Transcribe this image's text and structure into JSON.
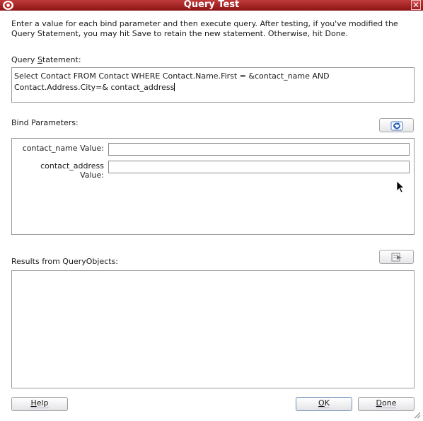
{
  "window": {
    "title": "Query Test",
    "close_glyph": "✕"
  },
  "instructions": "Enter a value for each bind parameter and then execute query. After testing, if you've modified the Query Statement, you may hit Save to retain the new statement.  Otherwise, hit Done.",
  "query_statement": {
    "label_before": "Query ",
    "label_mnemonic": "S",
    "label_after": "tatement:",
    "value": "Select Contact FROM Contact WHERE Contact.Name.First = &contact_name AND Contact.Address.City=& contact_address"
  },
  "bind_parameters": {
    "label": "Bind Parameters:",
    "refresh_icon": "refresh-icon",
    "params": [
      {
        "label": "contact_name Value:",
        "value": ""
      },
      {
        "label": "contact_address Value:",
        "value": ""
      }
    ]
  },
  "results": {
    "label": "Results from QueryObjects:",
    "execute_icon": "execute-query-icon"
  },
  "buttons": {
    "help_mnemonic": "H",
    "help_rest": "elp",
    "ok_mnemonic": "O",
    "ok_rest": "K",
    "done_mnemonic": "D",
    "done_rest": "one"
  },
  "colors": {
    "titlebar": "#a82424",
    "accent_blue": "#3a6fc0"
  }
}
